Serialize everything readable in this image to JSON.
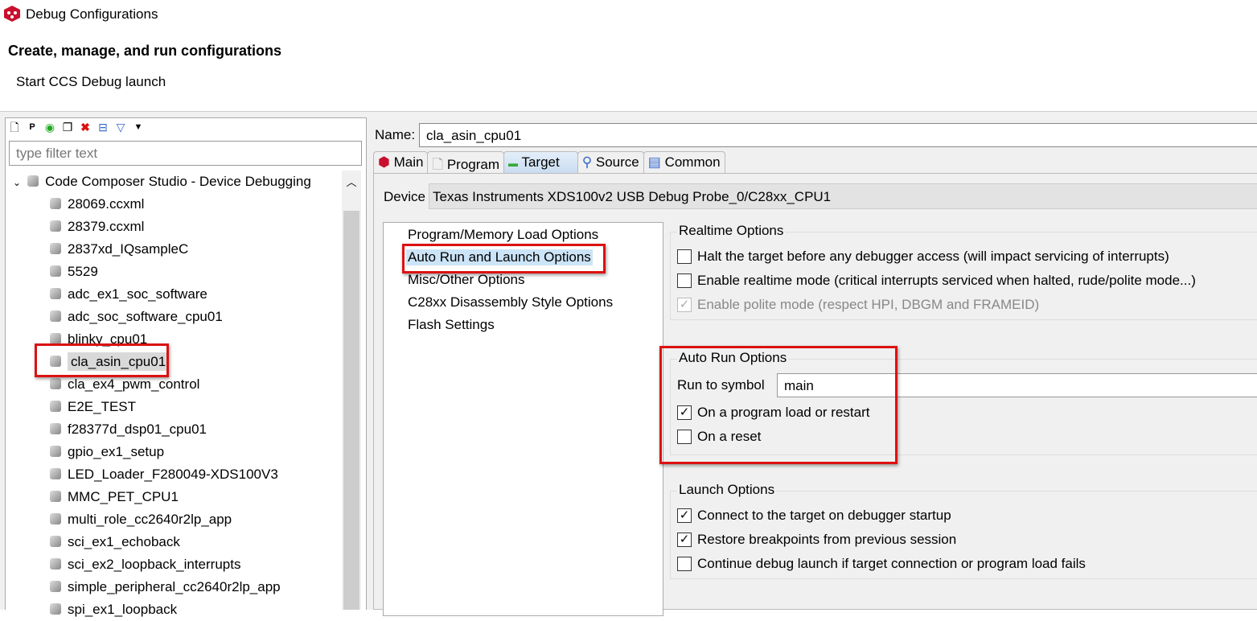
{
  "window": {
    "title": "Debug Configurations"
  },
  "header": {
    "title": "Create, manage, and run configurations",
    "subtitle": "Start CCS Debug launch"
  },
  "left": {
    "filter_placeholder": "type filter text",
    "root": "Code Composer Studio - Device Debugging",
    "items": [
      "28069.ccxml",
      "28379.ccxml",
      "2837xd_IQsampleC",
      "5529",
      "adc_ex1_soc_software",
      "adc_soc_software_cpu01",
      "blinky_cpu01",
      "cla_asin_cpu01",
      "cla_ex4_pwm_control",
      "E2E_TEST",
      "f28377d_dsp01_cpu01",
      "gpio_ex1_setup",
      "LED_Loader_F280049-XDS100V3",
      "MMC_PET_CPU1",
      "multi_role_cc2640r2lp_app",
      "sci_ex1_echoback",
      "sci_ex2_loopback_interrupts",
      "simple_peripheral_cc2640r2lp_app",
      "spi_ex1_loopback"
    ],
    "selected": "cla_asin_cpu01"
  },
  "name": {
    "label": "Name:",
    "value": "cla_asin_cpu01"
  },
  "tabs": [
    "Main",
    "Program",
    "Target",
    "Source",
    "Common"
  ],
  "active_tab": "Target",
  "device": {
    "label": "Device",
    "value": "Texas Instruments XDS100v2 USB Debug Probe_0/C28xx_CPU1"
  },
  "options": [
    "Program/Memory Load Options",
    "Auto Run and Launch Options",
    "Misc/Other Options",
    "C28xx Disassembly Style Options",
    "Flash Settings"
  ],
  "realtime": {
    "title": "Realtime Options",
    "items": [
      {
        "label": "Halt the target before any debugger access (will impact servicing of interrupts)",
        "checked": false
      },
      {
        "label": "Enable realtime mode (critical interrupts serviced when halted, rude/polite mode...)",
        "checked": false
      },
      {
        "label": "Enable polite mode (respect HPI, DBGM and FRAMEID)",
        "checked": true,
        "disabled": true
      }
    ]
  },
  "autorun": {
    "title": "Auto Run Options",
    "symbol_label": "Run to symbol",
    "symbol_value": "main",
    "items": [
      {
        "label": "On a program load or restart",
        "checked": true
      },
      {
        "label": "On a reset",
        "checked": false
      }
    ]
  },
  "launch": {
    "title": "Launch Options",
    "items": [
      {
        "label": "Connect to the target on debugger startup",
        "checked": true
      },
      {
        "label": "Restore breakpoints from previous session",
        "checked": true
      },
      {
        "label": "Continue debug launch if target connection or program load fails",
        "checked": false
      }
    ]
  },
  "colors": {
    "highlight": "#dd1111",
    "selection": "#cce4f7"
  }
}
